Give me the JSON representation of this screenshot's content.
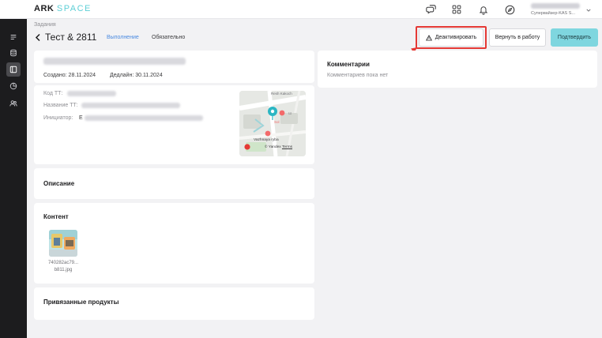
{
  "app": {
    "logo_main": "ARK",
    "logo_accent": "SPACE"
  },
  "header": {
    "user_role": "Супервайзер-KAS S..."
  },
  "breadcrumb": "Задания",
  "page": {
    "title": "Тест & 2811",
    "tag_execution": "Выполнение",
    "tag_required": "Обязательно"
  },
  "actions": {
    "deactivate": "Деактивировать",
    "return": "Вернуть в работу",
    "confirm": "Подтвердить"
  },
  "task": {
    "created": "Создано: 28.11.2024",
    "deadline": "Дедлайн: 30.11.2024",
    "code_label": "Код ТТ:",
    "name_label": "Название ТТ:",
    "initiator_label": "Инициатор:",
    "initiator_initial": "Е"
  },
  "map": {
    "street": "Resh Kakoch",
    "place": "Vazhnaya ryba",
    "poi": "Ш",
    "poi2": "Sol",
    "attribution": "© Yandex",
    "terms": "Terms"
  },
  "sections": {
    "description": "Описание",
    "content": "Контент",
    "products": "Привязанные продукты"
  },
  "content": {
    "file_name_line1": "740282ac79...",
    "file_name_line2": "b811.jpg"
  },
  "comments": {
    "title": "Комментарии",
    "empty": "Комментариев пока нет"
  },
  "colors": {
    "accent": "#7fd6df",
    "link": "#4a8ae0",
    "highlight": "#e53935",
    "sidebar": "#1c1c1e"
  }
}
